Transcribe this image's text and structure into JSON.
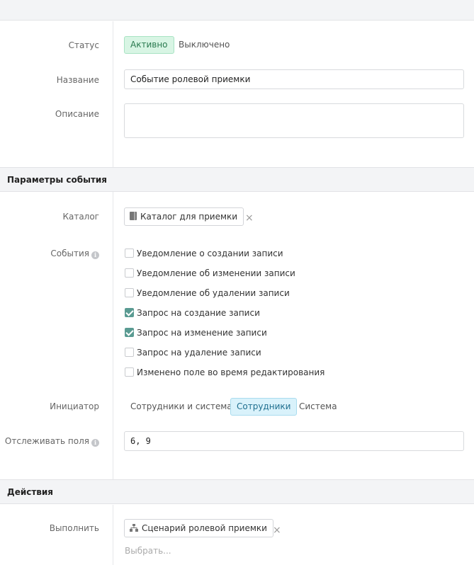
{
  "general": {
    "status_label": "Статус",
    "status_options": [
      "Активно",
      "Выключено"
    ],
    "name_label": "Название",
    "name_value": "Событие ролевой приемки",
    "description_label": "Описание",
    "description_value": ""
  },
  "event_params": {
    "section_title": "Параметры события",
    "catalog_label": "Каталог",
    "catalog_value": "Каталог для приемки",
    "events_label": "События",
    "events": [
      {
        "label": "Уведомление о создании записи",
        "checked": false
      },
      {
        "label": "Уведомление об изменении записи",
        "checked": false
      },
      {
        "label": "Уведомление об удалении записи",
        "checked": false
      },
      {
        "label": "Запрос на создание записи",
        "checked": true
      },
      {
        "label": "Запрос на изменение записи",
        "checked": true
      },
      {
        "label": "Запрос на удаление записи",
        "checked": false
      },
      {
        "label": "Изменено поле во время редактирования",
        "checked": false
      }
    ],
    "initiator_label": "Инициатор",
    "initiator_options": [
      "Сотрудники и система",
      "Сотрудники",
      "Система"
    ],
    "track_fields_label": "Отслеживать поля",
    "track_fields_value": "6, 9"
  },
  "actions": {
    "section_title": "Действия",
    "execute_label": "Выполнить",
    "execute_value": "Сценарий ролевой приемки",
    "select_placeholder": "Выбрать..."
  },
  "colors": {
    "active_green_bg": "#d8f5e4",
    "active_blue_bg": "#d9f2fb",
    "checkbox_checked": "#5a9b92"
  }
}
